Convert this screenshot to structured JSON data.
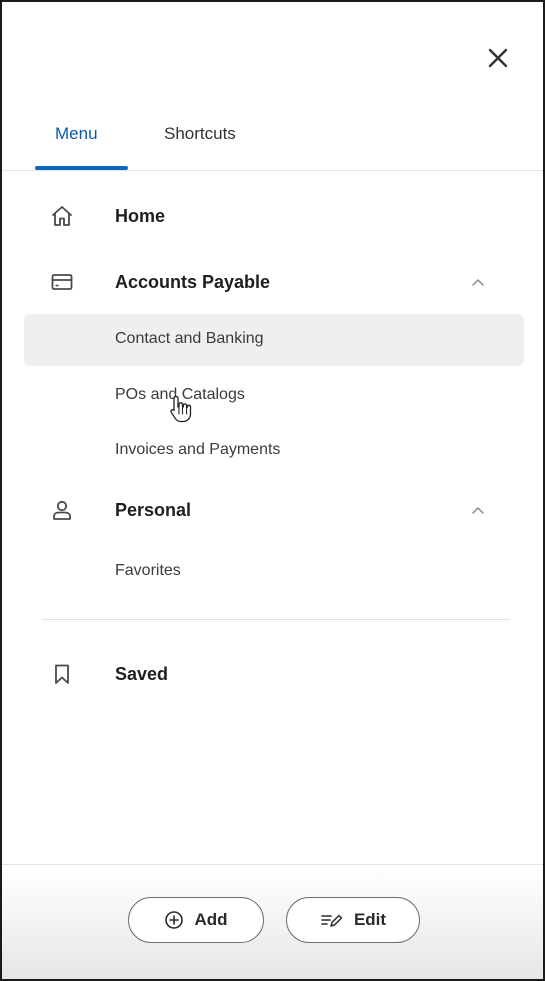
{
  "header": {
    "close_icon": "close-icon"
  },
  "tabs": [
    {
      "label": "Menu",
      "active": true
    },
    {
      "label": "Shortcuts",
      "active": false
    }
  ],
  "menu": {
    "home": {
      "label": "Home",
      "icon": "home-icon"
    },
    "accounts_payable": {
      "label": "Accounts Payable",
      "icon": "credit-card-icon",
      "expanded": true,
      "items": [
        {
          "label": "Contact and Banking",
          "hovered": true
        },
        {
          "label": "POs and Catalogs"
        },
        {
          "label": "Invoices and Payments"
        }
      ]
    },
    "personal": {
      "label": "Personal",
      "icon": "person-icon",
      "expanded": true,
      "items": [
        {
          "label": "Favorites"
        }
      ]
    },
    "saved": {
      "label": "Saved",
      "icon": "bookmark-icon"
    }
  },
  "footer": {
    "add_label": "Add",
    "edit_label": "Edit"
  },
  "colors": {
    "accent": "#0b67c2",
    "active_tab_text": "#0b5cad",
    "hover_bg": "#efefef"
  }
}
